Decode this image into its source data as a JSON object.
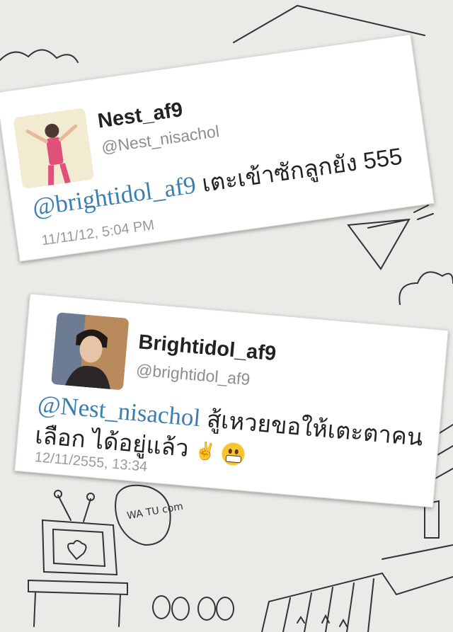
{
  "tweets": [
    {
      "display_name": "Nest_af9",
      "handle": "@Nest_nisachol",
      "mention": "@brightidol_af9",
      "text": " เตะเข้าซักลูกยัง 555",
      "timestamp": "11/11/12, 5:04 PM"
    },
    {
      "display_name": "Brightidol_af9",
      "handle": "@brightidol_af9",
      "mention": "@Nest_nisachol",
      "text_line1": " สู้เหวยขอให้เตะตาคน",
      "text_line2": "เลือก ได้อยู่แล้ว",
      "peace_emoji": "✌",
      "smile_emoji_icon": "grinning-face-icon",
      "timestamp": "12/11/2555, 13:34"
    }
  ],
  "background": {
    "speech_bubble_text": "WA TU com"
  }
}
